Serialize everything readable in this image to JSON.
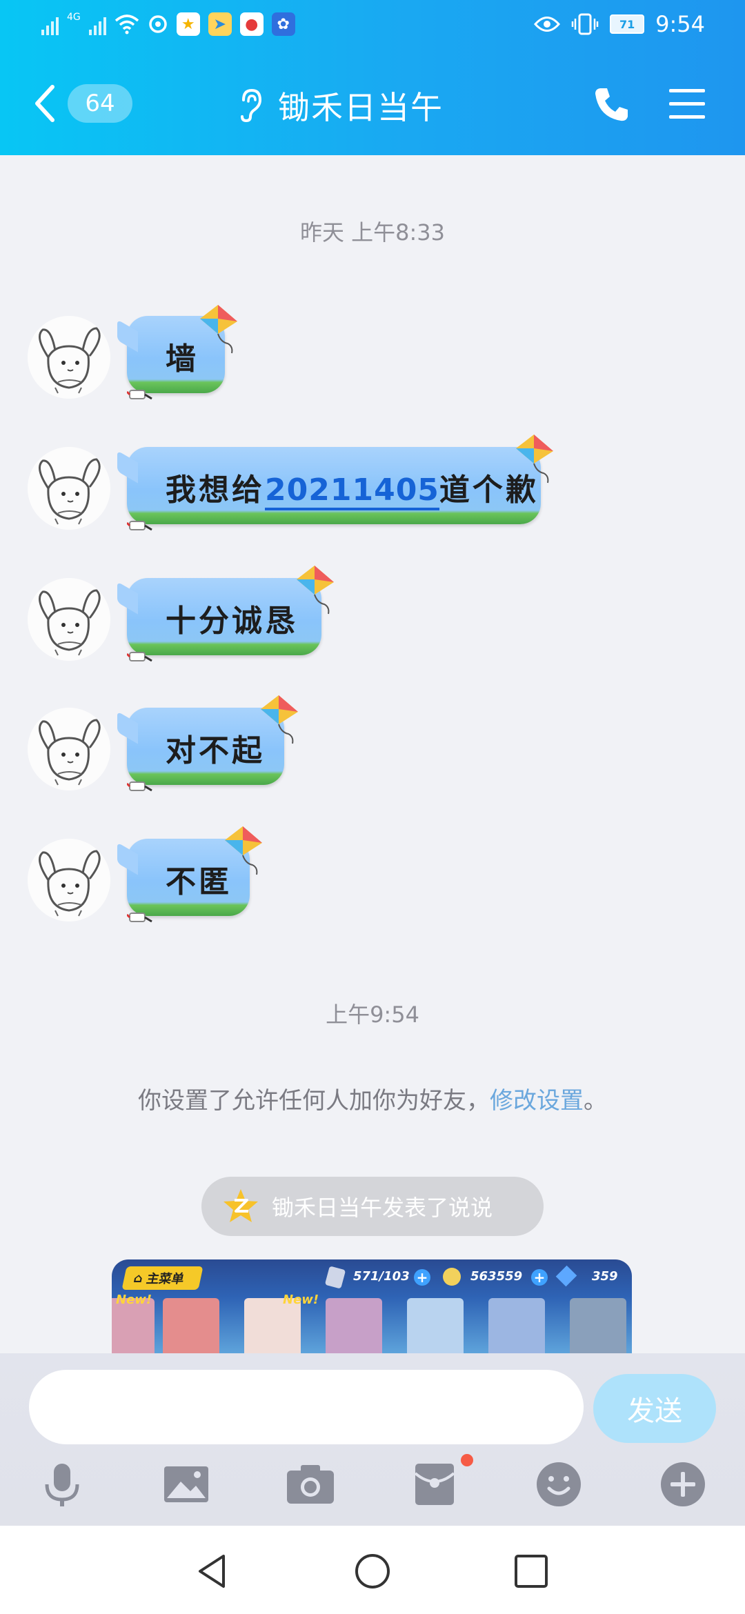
{
  "status_bar": {
    "network_label": "4G",
    "battery": "71",
    "time": "9:54"
  },
  "header": {
    "unread_count": "64",
    "title": "锄禾日当午"
  },
  "chat": {
    "timestamp_1": "昨天 上午8:33",
    "timestamp_2": "上午9:54",
    "messages": [
      {
        "text": "墙"
      },
      {
        "text_before": "我想给",
        "link": "20211405",
        "text_after": "道个歉"
      },
      {
        "text": "十分诚恳"
      },
      {
        "text": "对不起"
      },
      {
        "text": "不匿"
      }
    ],
    "system_note": {
      "text": "你设置了允许任何人加你为好友，",
      "link": "修改设置",
      "end": "。"
    },
    "feed_notice": "锄禾日当午发表了说说",
    "preview": {
      "menu_label": "主菜单",
      "stat_1": "571/103",
      "stat_2": "563559",
      "stat_3": "359",
      "new_label": "New!"
    }
  },
  "input": {
    "placeholder": "",
    "send_label": "发送"
  },
  "icons": {
    "back": "chevron-left-icon",
    "ear": "ear-icon",
    "phone": "phone-icon",
    "menu": "menu-icon",
    "mic": "mic-icon",
    "image": "image-icon",
    "camera": "camera-icon",
    "red_packet": "red-packet-icon",
    "emoji": "emoji-icon",
    "plus": "plus-icon"
  },
  "colors": {
    "header_start": "#08c6f4",
    "header_end": "#1e96ef",
    "link": "#6aa7dd",
    "send_button": "#aee2fb",
    "notification_dot": "#f65b45"
  }
}
